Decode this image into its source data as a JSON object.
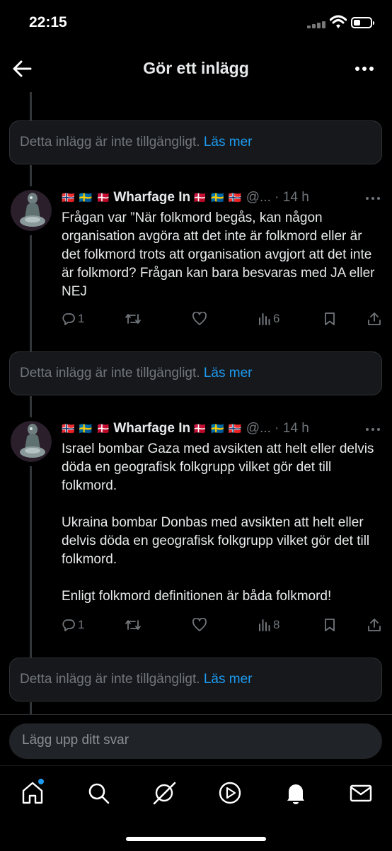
{
  "status_bar": {
    "time": "22:15"
  },
  "header": {
    "title": "Gör ett inlägg"
  },
  "unavailable": {
    "text": "Detta inlägg är inte tillgängligt.",
    "link": "Läs mer"
  },
  "posts": [
    {
      "flags_left": "🇳🇴 🇸🇪 🇩🇰",
      "author": "Wharfage In",
      "flags_right": "🇩🇰 🇸🇪 🇳🇴",
      "handle": "@...",
      "time": "· 14 h",
      "paragraphs": [
        "Frågan var ”När folkmord begås, kan någon organisation avgöra att det inte är folkmord eller är det folkmord trots att organisation avgjort att det inte är folkmord? Frågan kan bara besvaras med JA eller NEJ"
      ],
      "replies": "1",
      "views": "6"
    },
    {
      "flags_left": "🇳🇴 🇸🇪 🇩🇰",
      "author": "Wharfage In",
      "flags_right": "🇩🇰 🇸🇪 🇳🇴",
      "handle": "@...",
      "time": "· 14 h",
      "paragraphs": [
        "Israel bombar Gaza med avsikten att helt eller delvis döda en geografisk folkgrupp vilket gör det till folkmord.",
        "Ukraina bombar Donbas med avsikten att helt eller delvis döda en geografisk folkgrupp vilket gör det till folkmord.",
        "Enligt folkmord definitionen är båda folkmord!"
      ],
      "replies": "1",
      "views": "8"
    }
  ],
  "reply": {
    "placeholder": "Lägg upp ditt svar"
  },
  "nav": [
    "home-icon",
    "search-icon",
    "grok-icon",
    "video-icon",
    "notifications-icon",
    "messages-icon"
  ],
  "colors": {
    "background": "#000000",
    "accent": "#1d9bf0",
    "muted": "#71767b",
    "text": "#e7e9ea"
  }
}
